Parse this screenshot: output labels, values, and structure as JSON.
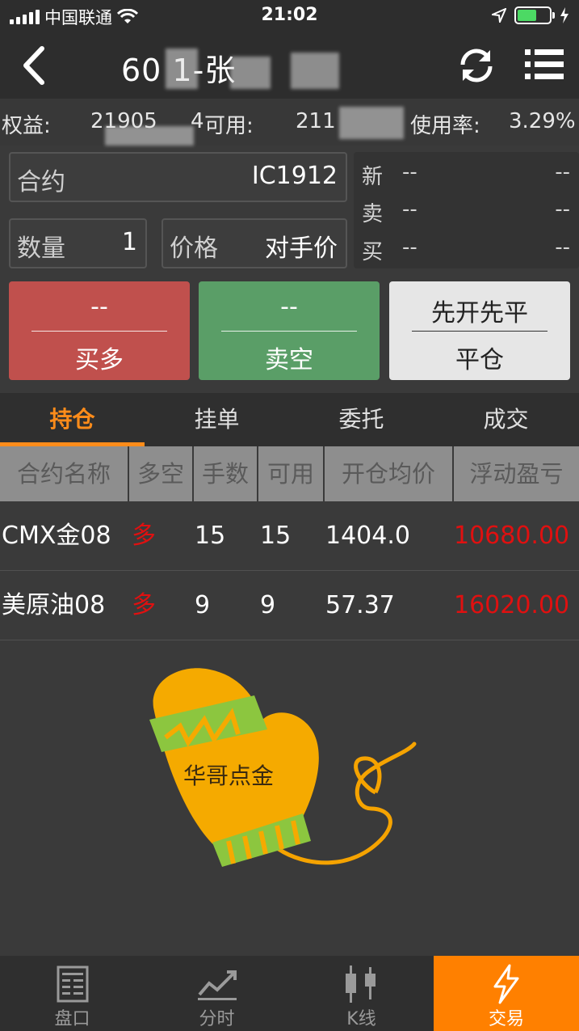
{
  "status_bar": {
    "carrier": "中国联通",
    "time": "21:02",
    "battery_color": "#4cd964"
  },
  "nav": {
    "title": "60    1-张"
  },
  "account": {
    "equity_label": "权益:",
    "equity_value": "21905",
    "frag": "4",
    "available_label": "可用:",
    "available_value": "211",
    "usage_label": "使用率:",
    "usage_value": "3.29%"
  },
  "order": {
    "contract_label": "合约",
    "contract_value": "IC1912",
    "qty_label": "数量",
    "qty_value": "1",
    "price_label": "价格",
    "price_value": "对手价"
  },
  "quote": [
    {
      "label": "新",
      "left": "--",
      "right": "--"
    },
    {
      "label": "卖",
      "left": "--",
      "right": "--"
    },
    {
      "label": "买",
      "left": "--",
      "right": "--"
    }
  ],
  "buttons": {
    "buy_top": "--",
    "buy_label": "买多",
    "sell_top": "--",
    "sell_label": "卖空",
    "close_top": "先开先平",
    "close_label": "平仓"
  },
  "tabs": [
    "持仓",
    "挂单",
    "委托",
    "成交"
  ],
  "table": {
    "headers": [
      "合约名称",
      "多空",
      "手数",
      "可用",
      "开仓均价",
      "浮动盈亏"
    ],
    "rows": [
      {
        "name": "CMX金08",
        "side": "多",
        "lots": "15",
        "avail": "15",
        "avg_price": "1404.0",
        "pnl": "10680.00"
      },
      {
        "name": "美原油08",
        "side": "多",
        "lots": "9",
        "avail": "9",
        "avg_price": "57.37",
        "pnl": "16020.00"
      }
    ]
  },
  "watermark": {
    "text": "华哥点金"
  },
  "bottom_nav": [
    {
      "label": "盘口",
      "icon": "order-book-icon"
    },
    {
      "label": "分时",
      "icon": "line-chart-icon"
    },
    {
      "label": "K线",
      "icon": "candlestick-icon"
    },
    {
      "label": "交易",
      "icon": "lightning-icon"
    }
  ],
  "colors": {
    "accent": "#ff8000",
    "buy": "#c0504d",
    "sell": "#5a9e67",
    "profit": "#e01010"
  }
}
